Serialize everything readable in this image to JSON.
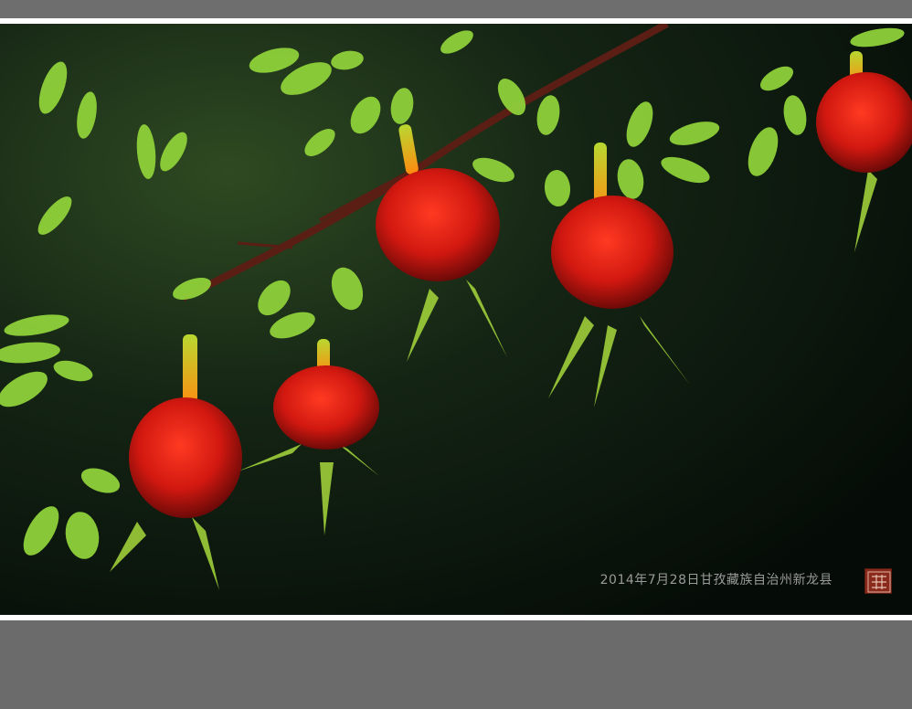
{
  "photo": {
    "caption": "2014年7月28日甘孜藏族自治州新龙县",
    "seal_icon": "red-seal-stamp-icon",
    "colors": {
      "background_dark": "#0d1a10",
      "leaf_green": "#8fd13a",
      "berry_red": "#d61a12",
      "branch_brown": "#5a1e14",
      "frame_gray": "#6b6b6b",
      "caption_gray": "#9a9a9a"
    }
  }
}
